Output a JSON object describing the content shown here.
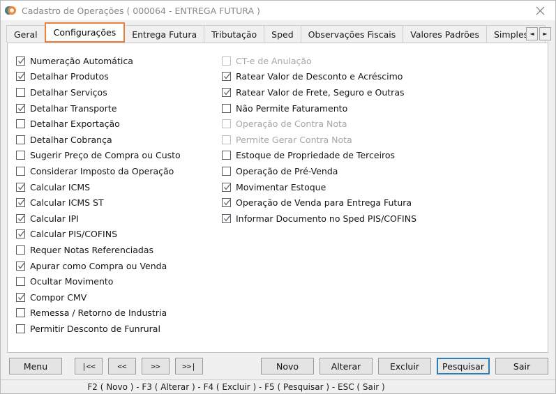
{
  "window": {
    "title": "Cadastro de Operações ( 000064 - ENTREGA FUTURA )",
    "icon": "app-logo-icon",
    "close_label": "close-icon",
    "accent_color": "#e8813a",
    "focus_color": "#2f7cb5"
  },
  "tabs": {
    "items": [
      {
        "label": "Geral",
        "active": false
      },
      {
        "label": "Configurações",
        "active": true
      },
      {
        "label": "Entrega Futura",
        "active": false
      },
      {
        "label": "Tributação",
        "active": false
      },
      {
        "label": "Sped",
        "active": false
      },
      {
        "label": "Observações Fiscais",
        "active": false
      },
      {
        "label": "Valores Padrões",
        "active": false
      },
      {
        "label": "Simples N",
        "active": false
      }
    ],
    "scroll_left": "◄",
    "scroll_right": "►"
  },
  "options_left": [
    {
      "label": "Numeração Automática",
      "checked": true,
      "disabled": false
    },
    {
      "label": "Detalhar Produtos",
      "checked": true,
      "disabled": false
    },
    {
      "label": "Detalhar Serviços",
      "checked": false,
      "disabled": false
    },
    {
      "label": "Detalhar Transporte",
      "checked": true,
      "disabled": false
    },
    {
      "label": "Detalhar Exportação",
      "checked": false,
      "disabled": false
    },
    {
      "label": "Detalhar Cobrança",
      "checked": false,
      "disabled": false
    },
    {
      "label": "Sugerir Preço de Compra ou Custo",
      "checked": false,
      "disabled": false
    },
    {
      "label": "Considerar Imposto da Operação",
      "checked": false,
      "disabled": false
    },
    {
      "label": "Calcular ICMS",
      "checked": true,
      "disabled": false
    },
    {
      "label": "Calcular ICMS ST",
      "checked": true,
      "disabled": false
    },
    {
      "label": "Calcular IPI",
      "checked": true,
      "disabled": false
    },
    {
      "label": "Calcular PIS/COFINS",
      "checked": true,
      "disabled": false
    },
    {
      "label": "Requer Notas Referenciadas",
      "checked": false,
      "disabled": false
    },
    {
      "label": "Apurar como Compra ou Venda",
      "checked": true,
      "disabled": false
    },
    {
      "label": "Ocultar Movimento",
      "checked": false,
      "disabled": false
    },
    {
      "label": "Compor CMV",
      "checked": true,
      "disabled": false
    },
    {
      "label": "Remessa / Retorno de Industria",
      "checked": false,
      "disabled": false
    },
    {
      "label": "Permitir Desconto de Funrural",
      "checked": false,
      "disabled": false
    }
  ],
  "options_right": [
    {
      "label": "CT-e de Anulação",
      "checked": false,
      "disabled": true
    },
    {
      "label": "Ratear Valor de Desconto e Acréscimo",
      "checked": true,
      "disabled": false
    },
    {
      "label": "Ratear Valor de Frete, Seguro e Outras",
      "checked": true,
      "disabled": false
    },
    {
      "label": "Não Permite Faturamento",
      "checked": false,
      "disabled": false
    },
    {
      "label": "Operação de Contra Nota",
      "checked": false,
      "disabled": true
    },
    {
      "label": "Permite Gerar Contra Nota",
      "checked": false,
      "disabled": true
    },
    {
      "label": "Estoque de Propriedade de Terceiros",
      "checked": false,
      "disabled": false
    },
    {
      "label": "Operação de Pré-Venda",
      "checked": false,
      "disabled": false
    },
    {
      "label": "Movimentar Estoque",
      "checked": true,
      "disabled": false
    },
    {
      "label": "Operação de Venda para Entrega Futura",
      "checked": true,
      "disabled": false
    },
    {
      "label": "Informar Documento no Sped PIS/COFINS",
      "checked": true,
      "disabled": false
    }
  ],
  "buttons": {
    "menu": "Menu",
    "first": "|<<",
    "prev": "<<",
    "next": ">>",
    "last": ">>|",
    "novo": "Novo",
    "alterar": "Alterar",
    "excluir": "Excluir",
    "pesquisar": "Pesquisar",
    "sair": "Sair",
    "focused": "pesquisar"
  },
  "statusbar": {
    "text": "F2 ( Novo )  -  F3 ( Alterar )  -  F4 ( Excluir )  -  F5 ( Pesquisar )  -  ESC ( Sair )"
  }
}
